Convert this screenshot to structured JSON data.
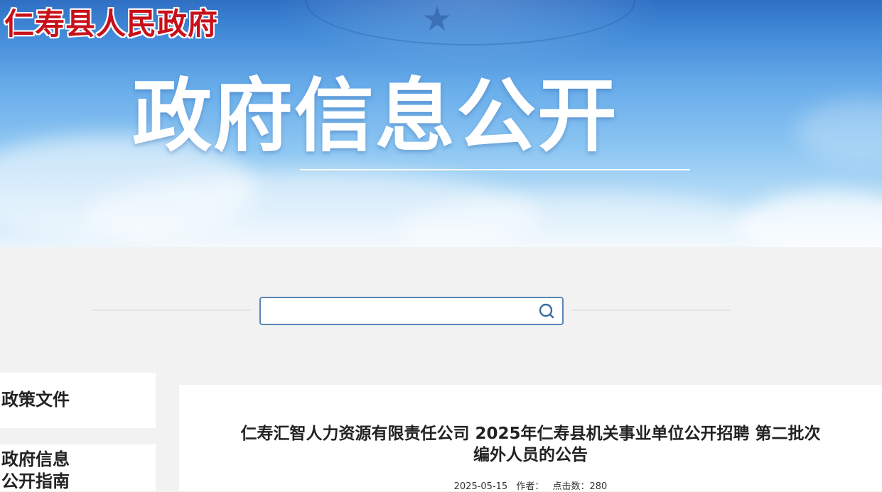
{
  "header": {
    "site_title": "仁寿县人民政府",
    "banner_heading": "政府信息公开"
  },
  "search": {
    "placeholder": "",
    "value": "",
    "button_icon": "search-icon",
    "accent_color": "#5a86b6"
  },
  "sidebar": {
    "items": [
      {
        "label": "政策文件"
      },
      {
        "label_line1": "政府信息",
        "label_line2": "公开指南"
      }
    ]
  },
  "article": {
    "title_line1": "仁寿汇智人力资源有限责任公司 2025年仁寿县机关事业单位公开招聘 第二批次",
    "title_line2": "编外人员的公告",
    "date": "2025-05-15",
    "author_label": "作者：",
    "author": "",
    "views_label": "点击数：",
    "views": "280"
  },
  "colors": {
    "title_red": "#c8101a",
    "page_bg": "#f2f2f2"
  }
}
